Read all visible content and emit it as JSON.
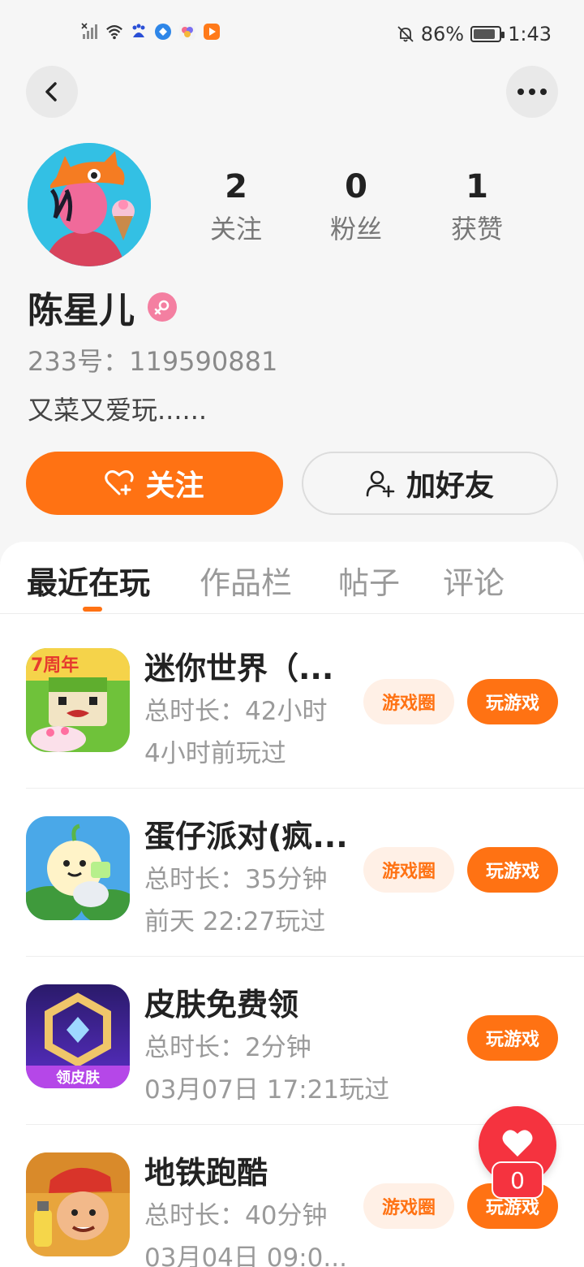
{
  "status_bar": {
    "battery": "86%",
    "battery_level": 0.86,
    "time": "1:43",
    "icons": [
      "signal-off-icon",
      "wifi-icon",
      "baidu-icon",
      "browser-icon",
      "app-icon",
      "video-icon",
      "bell-off-icon",
      "battery-icon"
    ]
  },
  "header": {
    "back_icon": "chevron-left-icon",
    "more_icon": "more-horizontal-icon"
  },
  "profile": {
    "stats": [
      {
        "value": "2",
        "label": "关注"
      },
      {
        "value": "0",
        "label": "粉丝"
      },
      {
        "value": "1",
        "label": "获赞"
      }
    ],
    "name": "陈星儿",
    "gender_icon": "female-icon",
    "uid": "233号：119590881",
    "bio": "又菜又爱玩......"
  },
  "actions": {
    "follow_label": "关注",
    "add_friend_label": "加好友"
  },
  "tabs": [
    {
      "label": "最近在玩",
      "active": true
    },
    {
      "label": "作品栏",
      "active": false
    },
    {
      "label": "帖子",
      "active": false
    },
    {
      "label": "评论",
      "active": false
    }
  ],
  "games": [
    {
      "title": "迷你世界（...",
      "duration": "总时长：42小时",
      "last_played": "4小时前玩过",
      "circle_label": "游戏圈",
      "play_label": "玩游戏"
    },
    {
      "title": "蛋仔派对(疯...",
      "duration": "总时长：35分钟",
      "last_played": "前天 22:27玩过",
      "circle_label": "游戏圈",
      "play_label": "玩游戏"
    },
    {
      "title": "皮肤免费领",
      "duration": "总时长：2分钟",
      "last_played": "03月07日 17:21玩过",
      "icon_caption": "领皮肤",
      "circle_label": "",
      "play_label": "玩游戏"
    },
    {
      "title": "地铁跑酷",
      "duration": "总时长：40分钟",
      "last_played": "03月04日 09:0...",
      "circle_label": "游戏圈",
      "play_label": "玩游戏"
    }
  ],
  "floating_like": {
    "count": "0",
    "icon": "heart-icon"
  },
  "colors": {
    "accent": "#ff7213",
    "like_red": "#f5333f",
    "chip_bg": "#fff0e6"
  }
}
